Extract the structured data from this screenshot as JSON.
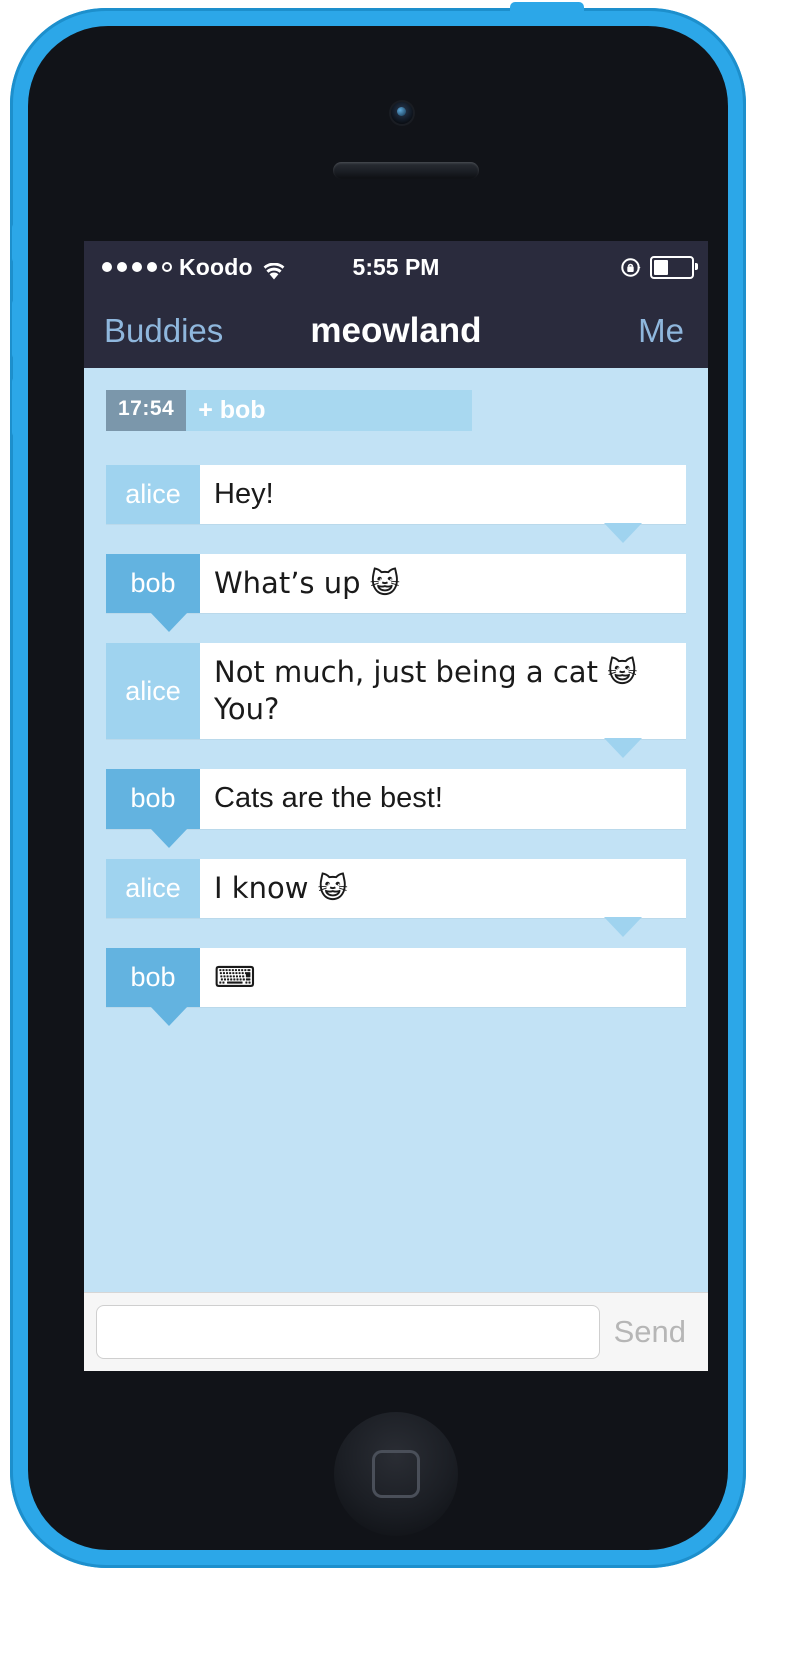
{
  "device": {
    "model": "iphone-5c-blue",
    "body_color": "#2ca7e8"
  },
  "status_bar": {
    "signal_dots": [
      true,
      true,
      true,
      true,
      false
    ],
    "carrier": "Koodo",
    "wifi_icon": "wifi-icon",
    "time": "5:55 PM",
    "rotation_lock_icon": "rotation-lock-icon",
    "battery_icon": "battery-icon",
    "battery_level_percent": 45
  },
  "nav_bar": {
    "back_label": "Buddies",
    "title": "meowland",
    "right_label": "Me"
  },
  "conversation": {
    "join_event": {
      "time": "17:54",
      "text": "+ bob"
    },
    "messages": [
      {
        "sender": "alice",
        "text": "Hey!",
        "tail": "right"
      },
      {
        "sender": "bob",
        "text": "What’s up 😺",
        "tail": "left"
      },
      {
        "sender": "alice",
        "text": "Not much, just being a cat 😺 You?",
        "tail": "right"
      },
      {
        "sender": "bob",
        "text": "Cats are the best!",
        "tail": "left"
      },
      {
        "sender": "alice",
        "text": "I know 😺",
        "tail": "right"
      },
      {
        "sender": "bob",
        "text": "⌨",
        "tail": "left"
      }
    ]
  },
  "input_bar": {
    "value": "",
    "placeholder": "",
    "send_label": "Send"
  },
  "colors": {
    "nav_background": "#2a2b3d",
    "nav_tint": "#8fb7dd",
    "convo_background": "#c2e2f5",
    "alice_label": "#9fd3ef",
    "bob_label": "#63b3e0",
    "join_bar": "#a8d8f0",
    "join_time": "#7b97ab"
  }
}
